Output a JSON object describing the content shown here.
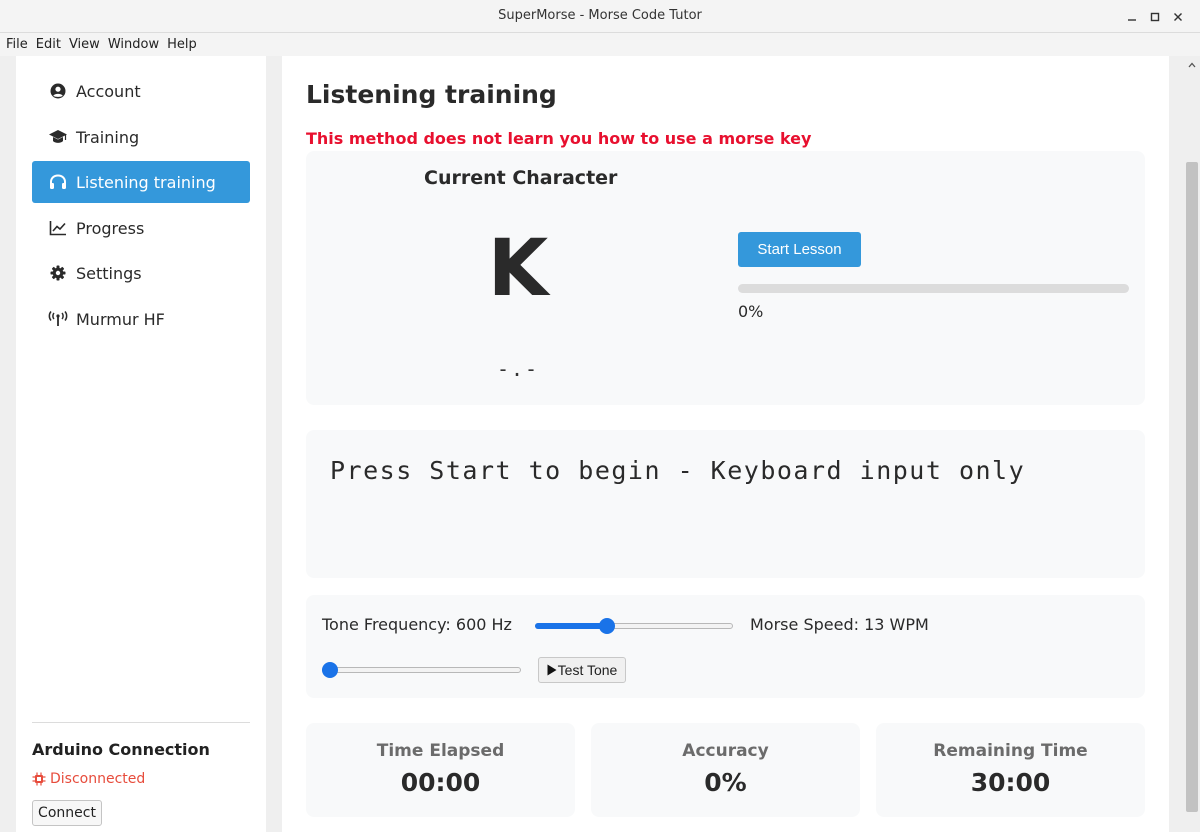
{
  "window": {
    "title": "SuperMorse - Morse Code Tutor",
    "minimize_icon": "minimize-icon",
    "maximize_icon": "maximize-icon",
    "close_icon": "close-icon"
  },
  "menu": [
    "File",
    "Edit",
    "View",
    "Window",
    "Help"
  ],
  "sidebar": {
    "items": [
      {
        "label": "Account",
        "icon": "user-circle-icon",
        "active": false
      },
      {
        "label": "Training",
        "icon": "graduation-cap-icon",
        "active": false
      },
      {
        "label": "Listening training",
        "icon": "headphones-icon",
        "active": true
      },
      {
        "label": "Progress",
        "icon": "line-chart-icon",
        "active": false
      },
      {
        "label": "Settings",
        "icon": "gear-icon",
        "active": false
      },
      {
        "label": "Murmur HF",
        "icon": "antenna-icon",
        "active": false
      }
    ],
    "arduino": {
      "heading": "Arduino Connection",
      "status": "Disconnected",
      "status_color": "#e74c3c",
      "connect_label": "Connect"
    }
  },
  "main": {
    "title": "Listening training",
    "warning": "This method does not learn you how to use a morse key",
    "warning_color": "#e8102f",
    "current_character_label": "Current Character",
    "character": "K",
    "morse": "-.-",
    "start_label": "Start Lesson",
    "progress": 0,
    "progress_text": "0%",
    "input_prompt": "Press Start to begin - Keyboard input only",
    "tone_label": "Tone Frequency: 600 Hz",
    "tone_fraction": 0.35,
    "speed_label": "Morse Speed: 13 WPM",
    "speed_fraction": 0.0,
    "test_tone_label": "Test Tone",
    "stats": [
      {
        "label": "Time Elapsed",
        "value": "00:00"
      },
      {
        "label": "Accuracy",
        "value": "0%"
      },
      {
        "label": "Remaining Time",
        "value": "30:00"
      }
    ]
  },
  "colors": {
    "accent": "#3498db",
    "slider": "#1a73e8"
  }
}
